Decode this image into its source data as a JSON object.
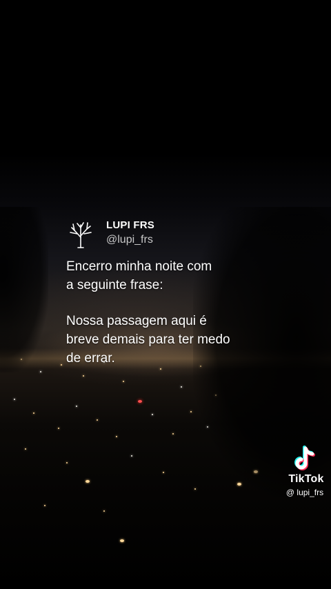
{
  "tweet": {
    "display_name": "LUPI FRS",
    "handle": "@lupi_frs",
    "avatar_icon": "tree-icon",
    "paragraphs": [
      [
        "Encerro minha noite com",
        "a seguinte frase:"
      ],
      [
        "Nossa passagem aqui é",
        "breve demais para ter medo",
        "de errar."
      ]
    ]
  },
  "watermark": {
    "logo_icon": "tiktok-logo-icon",
    "brand": "TikTok",
    "username": "@ lupi_frs"
  },
  "colors": {
    "background": "#000000",
    "text": "#ffffff",
    "handle": "#c9c9c9",
    "tiktok_cyan": "#25f4ee",
    "tiktok_red": "#fe2c55"
  }
}
